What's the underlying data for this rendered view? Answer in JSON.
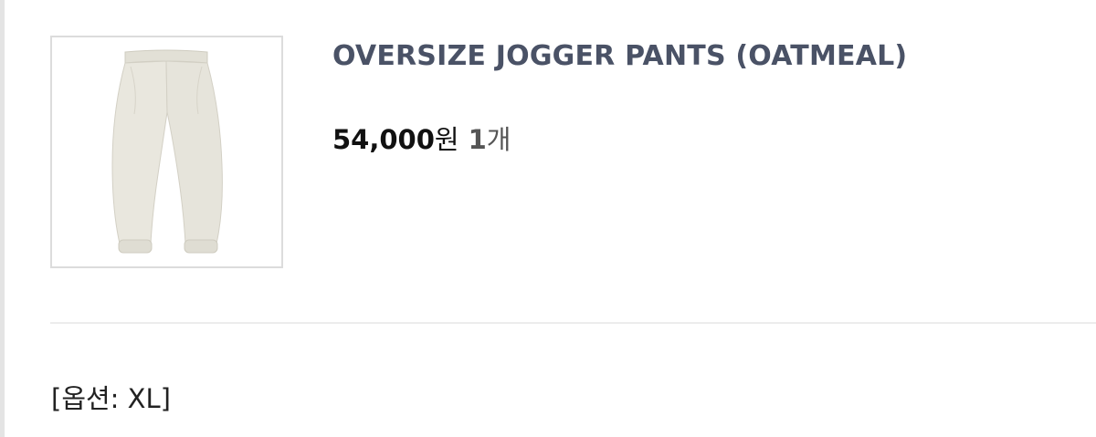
{
  "product": {
    "name": "OVERSIZE JOGGER PANTS (OATMEAL)",
    "price": "54,000",
    "currency": "원",
    "quantity": "1",
    "quantity_unit": "개",
    "option": "[옵션: XL]",
    "image_icon": "jogger-pants-image",
    "image_color": "#e7e5dc"
  }
}
